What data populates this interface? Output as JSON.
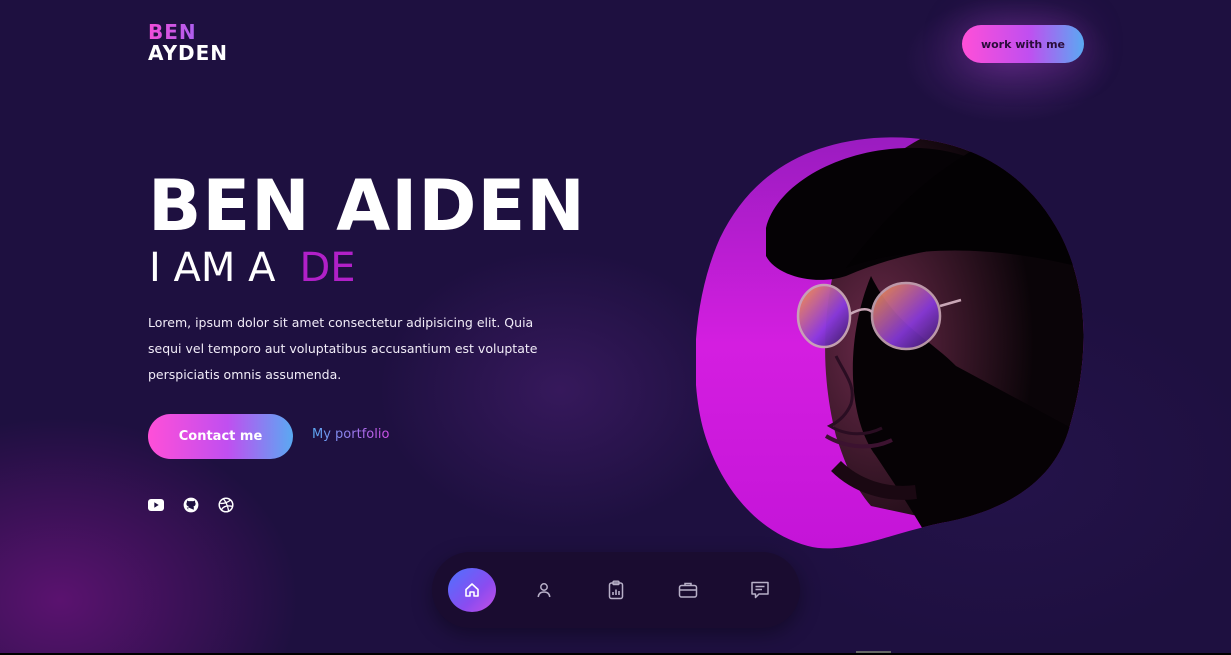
{
  "logo": {
    "line1": "BEN",
    "line2": "AYDEN"
  },
  "header": {
    "cta_label": "work with me"
  },
  "hero": {
    "name": "BEN AIDEN",
    "role_prefix": "I AM A",
    "role_typed": "DE",
    "description": "Lorem, ipsum dolor sit amet consectetur adipisicing elit. Quia sequi vel temporo aut voluptatibus accusantium est voluptate perspiciatis omnis assumenda.",
    "primary_button": "Contact me",
    "secondary_link": "My portfolio"
  },
  "socials": [
    {
      "icon": "youtube-icon"
    },
    {
      "icon": "github-icon"
    },
    {
      "icon": "dribbble-icon"
    }
  ],
  "dock": {
    "items": [
      {
        "icon": "home-icon",
        "active": true
      },
      {
        "icon": "user-icon",
        "active": false
      },
      {
        "icon": "clipboard-chart-icon",
        "active": false
      },
      {
        "icon": "briefcase-icon",
        "active": false
      },
      {
        "icon": "message-icon",
        "active": false
      }
    ]
  },
  "colors": {
    "background": "#1e1040",
    "accent_pink": "#ff4fd8",
    "accent_purple": "#b120c8",
    "accent_blue": "#5aa9f2",
    "dock_bg": "#1a0c30"
  }
}
